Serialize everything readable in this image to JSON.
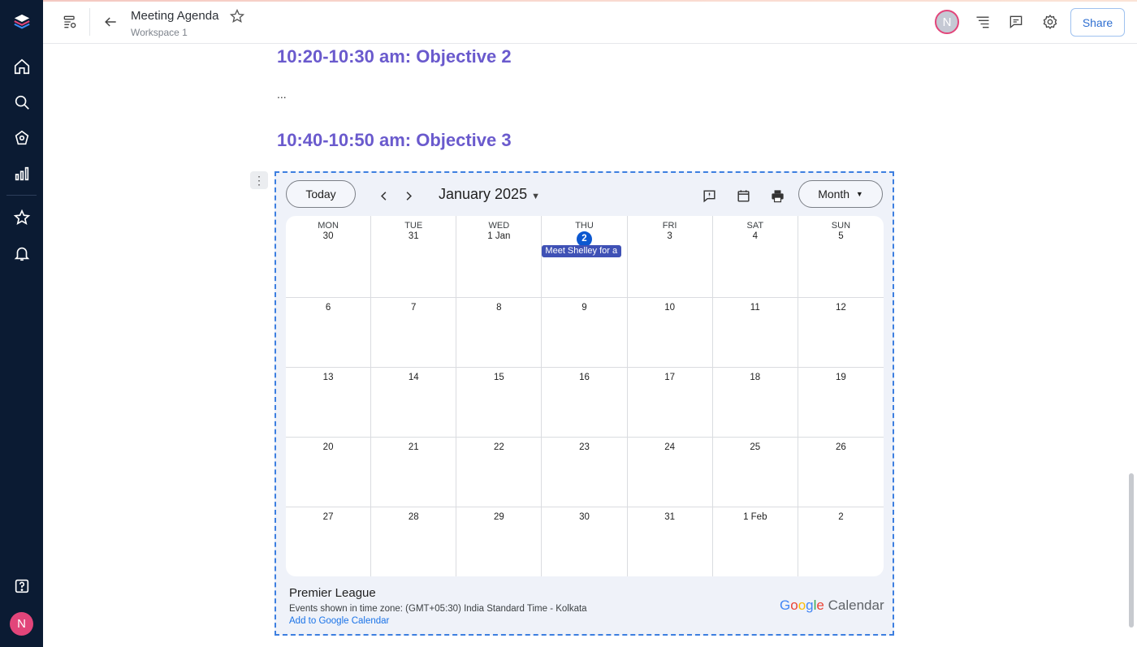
{
  "header": {
    "title": "Meeting Agenda",
    "workspace": "Workspace 1",
    "avatar_initial": "N",
    "share_label": "Share"
  },
  "sidebar": {
    "avatar_initial": "N"
  },
  "content": {
    "heading_objective2": "10:20-10:30 am: Objective 2",
    "ellipsis": "...",
    "heading_objective3": "10:40-10:50 am: Objective 3",
    "accent_color": "#6a5acd"
  },
  "calendar": {
    "today_label": "Today",
    "month_title": "January 2025",
    "view_label": "Month",
    "weekdays": [
      "MON",
      "TUE",
      "WED",
      "THU",
      "FRI",
      "SAT",
      "SUN"
    ],
    "weeks": [
      [
        "30",
        "31",
        "1 Jan",
        "2",
        "3",
        "4",
        "5"
      ],
      [
        "6",
        "7",
        "8",
        "9",
        "10",
        "11",
        "12"
      ],
      [
        "13",
        "14",
        "15",
        "16",
        "17",
        "18",
        "19"
      ],
      [
        "20",
        "21",
        "22",
        "23",
        "24",
        "25",
        "26"
      ],
      [
        "27",
        "28",
        "29",
        "30",
        "31",
        "1 Feb",
        "2"
      ]
    ],
    "today_cell": "2",
    "event_text": "Meet Shelley for a",
    "calendar_name": "Premier League",
    "timezone_text": "Events shown in time zone: (GMT+05:30) India Standard Time - Kolkata",
    "add_link": "Add to Google Calendar",
    "brand_google": "Google",
    "brand_calendar": "Calendar"
  }
}
